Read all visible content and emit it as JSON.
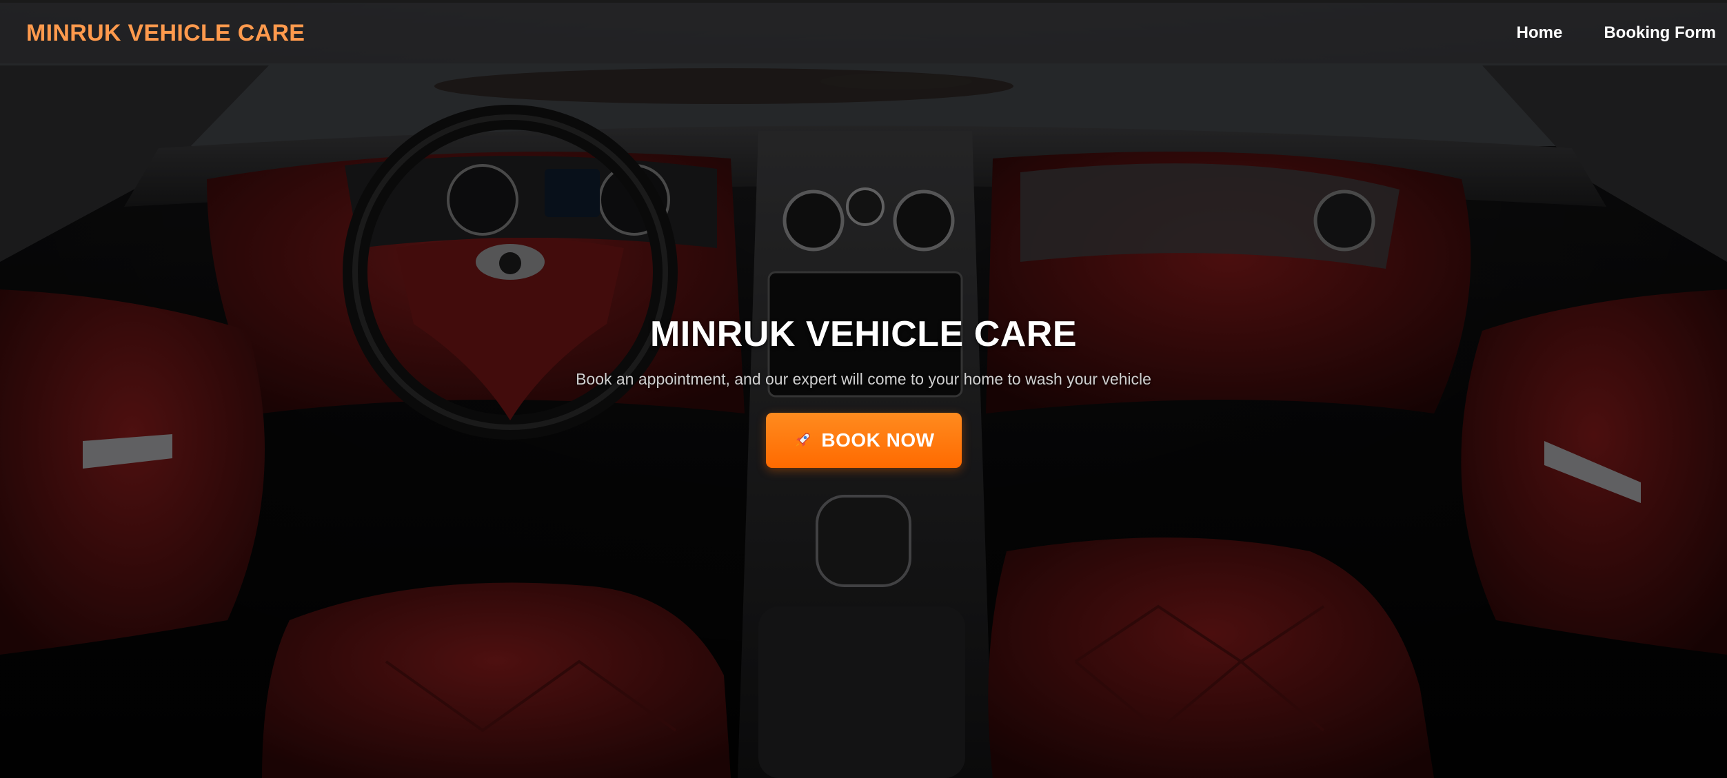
{
  "navbar": {
    "brand": "MINRUK VEHICLE CARE",
    "links": [
      {
        "label": "Home"
      },
      {
        "label": "Booking Form"
      }
    ]
  },
  "hero": {
    "title": "MINRUK VEHICLE CARE",
    "subtitle": "Book an appointment, and our expert will come to your home to wash your vehicle",
    "cta_label": "BOOK NOW",
    "cta_icon": "rocket-icon"
  },
  "colors": {
    "brand": "#ff9a4d",
    "cta": "#ff7a0f",
    "leather": "#7a1818"
  }
}
